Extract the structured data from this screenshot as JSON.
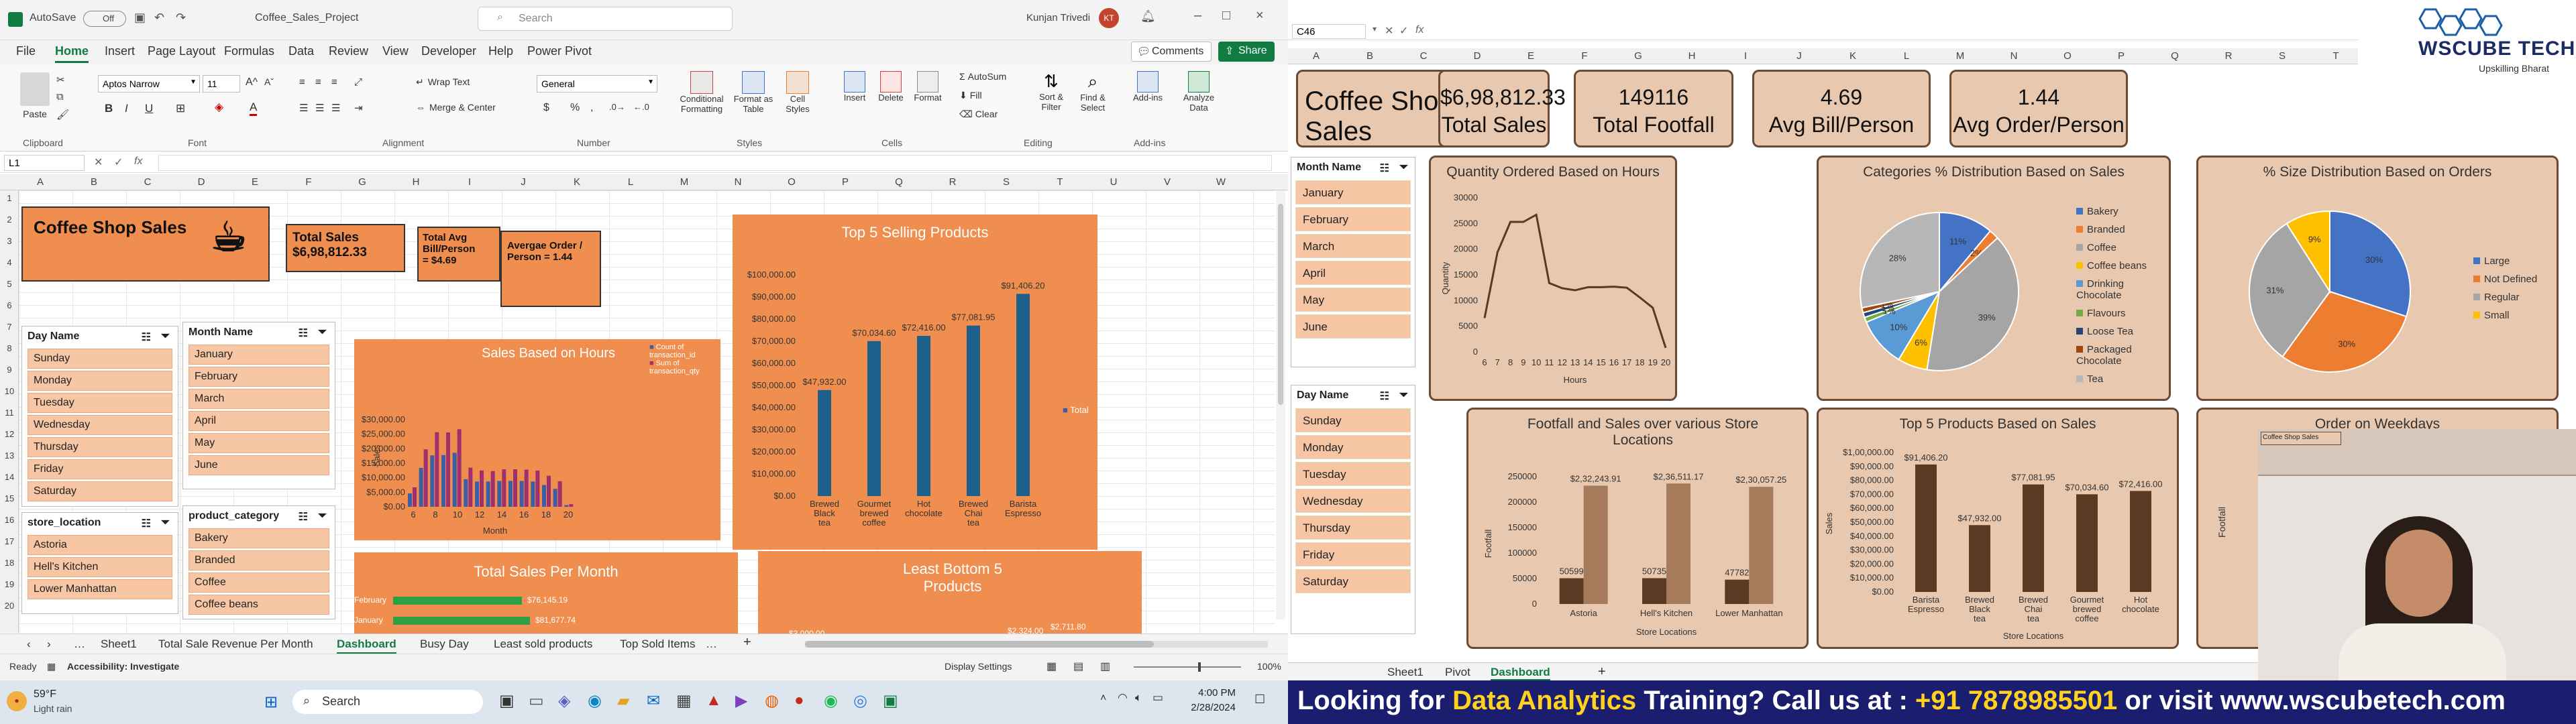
{
  "left": {
    "autosave": "AutoSave",
    "autosave_state": "Off",
    "file_name": "Coffee_Sales_Project",
    "search_placeholder": "Search",
    "user": "Kunjan Trivedi",
    "user_initials": "KT",
    "tabs": [
      "File",
      "Home",
      "Insert",
      "Page Layout",
      "Formulas",
      "Data",
      "Review",
      "View",
      "Developer",
      "Help",
      "Power Pivot"
    ],
    "comments": "Comments",
    "share": "Share",
    "ribbon": {
      "paste": "Paste",
      "clipboard": "Clipboard",
      "font_name": "Aptos Narrow",
      "font_size": "11",
      "font": "Font",
      "wrap_text": "Wrap Text",
      "merge_center": "Merge & Center",
      "alignment": "Alignment",
      "number_format": "General",
      "number": "Number",
      "conditional": "Conditional Formatting",
      "format_table": "Format as Table",
      "cell_styles": "Cell Styles",
      "styles": "Styles",
      "insert": "Insert",
      "delete": "Delete",
      "format": "Format",
      "cells": "Cells",
      "autosum": "AutoSum",
      "fill": "Fill",
      "clear": "Clear",
      "sort_filter": "Sort & Filter",
      "find_select": "Find & Select",
      "editing": "Editing",
      "addins": "Add-ins",
      "analyze": "Analyze Data"
    },
    "name_box": "L1",
    "columns": [
      "A",
      "B",
      "C",
      "D",
      "E",
      "F",
      "G",
      "H",
      "I",
      "J",
      "K",
      "L",
      "M",
      "N",
      "O",
      "P",
      "Q",
      "R",
      "S",
      "T",
      "U",
      "V",
      "W"
    ],
    "rows": [
      "1",
      "2",
      "3",
      "4",
      "5",
      "6",
      "7",
      "8",
      "9",
      "10",
      "11",
      "12",
      "13",
      "14",
      "15",
      "16",
      "17",
      "18",
      "19",
      "20"
    ],
    "title_card": "Coffee Shop Sales",
    "total_sales_label": "Total Sales",
    "total_sales_value": "$6,98,812.33",
    "avg_bill_label": "Total Avg Bill/Person",
    "avg_bill_value": "= $4.69",
    "avg_order": "Avergae Order / Person = 1.44",
    "day_slicer": {
      "title": "Day Name",
      "items": [
        "Sunday",
        "Monday",
        "Tuesday",
        "Wednesday",
        "Thursday",
        "Friday",
        "Saturday"
      ]
    },
    "month_slicer": {
      "title": "Month Name",
      "items": [
        "January",
        "February",
        "March",
        "April",
        "May",
        "June"
      ]
    },
    "store_slicer": {
      "title": "store_location",
      "items": [
        "Astoria",
        "Hell's Kitchen",
        "Lower Manhattan"
      ]
    },
    "category_slicer": {
      "title": "product_category",
      "items": [
        "Bakery",
        "Branded",
        "Coffee",
        "Coffee beans"
      ]
    },
    "sales_hours_title": "Sales Based on Hours",
    "sales_hours_legend": [
      "Count of transaction_id",
      "Sum of transaction_qty"
    ],
    "sales_hours_ylabel": "Sales",
    "sales_hours_xlabel": "Month",
    "sales_hours_yticks": [
      "$30,000.00",
      "$25,000.00",
      "$20,000.00",
      "$15,000.00",
      "$10,000.00",
      "$5,000.00",
      "$0.00"
    ],
    "sales_hours_xticks": [
      "6",
      "8",
      "10",
      "12",
      "14",
      "16",
      "18",
      "20"
    ],
    "top5_title": "Top 5 Selling Products",
    "top5_legend": "Total",
    "total_per_month_title": "Total Sales Per Month",
    "total_per_month_rows": [
      {
        "label": "February",
        "value": "$76,145.19"
      },
      {
        "label": "January",
        "value": "$81,677.74"
      }
    ],
    "least5_title": "Least Bottom 5 Products",
    "least5_values": [
      "$3,000.00",
      "$2,324.00",
      "$2,711.80"
    ],
    "sheet_tabs": [
      "Sheet1",
      "Total Sale Revenue Per Month",
      "Dashboard",
      "Busy Day",
      "Least sold products",
      "Top Sold Items"
    ],
    "active_sheet": "Dashboard",
    "status_ready": "Ready",
    "accessibility": "Accessibility: Investigate",
    "display_settings": "Display Settings",
    "zoom": "100%"
  },
  "right": {
    "name_box": "C46",
    "columns": [
      "A",
      "B",
      "C",
      "D",
      "E",
      "F",
      "G",
      "H",
      "I",
      "J",
      "K",
      "L",
      "M",
      "N",
      "O",
      "P",
      "Q",
      "R",
      "S",
      "T"
    ],
    "title": "Coffee Shop Sales",
    "kpis": [
      {
        "value": "$6,98,812.33",
        "label": "Total Sales"
      },
      {
        "value": "149116",
        "label": "Total Footfall"
      },
      {
        "value": "4.69",
        "label": "Avg Bill/Person"
      },
      {
        "value": "1.44",
        "label": "Avg Order/Person"
      }
    ],
    "month_slicer": {
      "title": "Month Name",
      "items": [
        "January",
        "February",
        "March",
        "April",
        "May",
        "June"
      ]
    },
    "day_slicer": {
      "title": "Day Name",
      "items": [
        "Sunday",
        "Monday",
        "Tuesday",
        "Wednesday",
        "Thursday",
        "Friday",
        "Saturday"
      ]
    },
    "qty_hours_title": "Quantity Ordered Based on Hours",
    "qty_hours_ylabel": "Quantity",
    "qty_hours_xlabel": "Hours",
    "categories_title": "Categories % Distribution Based on Sales",
    "categories_legend": [
      "Bakery",
      "Branded",
      "Coffee",
      "Coffee beans",
      "Drinking Chocolate",
      "Flavours",
      "Loose Tea",
      "Packaged Chocolate",
      "Tea"
    ],
    "size_title": "% Size Distribution Based on Orders",
    "size_legend": [
      "Large",
      "Not Defined",
      "Regular",
      "Small"
    ],
    "footfall_title": "Footfall and Sales over various Store Locations",
    "footfall_ylabel": "Footfall",
    "footfall_xlabel": "Store Locations",
    "top5_title": "Top 5 Products Based on Sales",
    "top5_ylabel": "Sales",
    "top5_xlabel": "Store Locations",
    "weekday_title": "Order on Weekdays",
    "weekday_ylabel": "Footfall",
    "sheet_tabs": [
      "Sheet1",
      "Pivot",
      "Dashboard"
    ],
    "active_sheet": "Dashboard"
  },
  "taskbar": {
    "weather_temp": "59°F",
    "weather_desc": "Light rain",
    "search": "Search",
    "time": "4:00 PM",
    "date": "2/28/2024"
  },
  "logo": {
    "name": "WSCUBE TECH",
    "tagline": "Upskilling Bharat"
  },
  "banner": {
    "part1": "Looking for ",
    "part2": "Data Analytics",
    "part3": " Training? Call us at : ",
    "part4": "+91 7878985501",
    "part5": " or visit www.wscubetech.com"
  },
  "colors": {
    "accent_orange": "#ef8e4e",
    "panel_bg": "#e8c9b0",
    "panel_border": "#6b4a33",
    "brown_dark": "#5a3a22",
    "brown_light": "#a67b5b",
    "excel_green": "#107c41",
    "banner_bg": "#1b1d6e",
    "banner_yellow": "#ffd21f"
  },
  "chart_data": [
    {
      "type": "bar",
      "title": "Top 5 Selling Products",
      "categories": [
        "Brewed Black tea",
        "Gourmet brewed coffee",
        "Hot chocolate",
        "Brewed Chai tea",
        "Barista Espresso"
      ],
      "values": [
        47932,
        70034.6,
        72416,
        77081.95,
        91406.2
      ],
      "labels": [
        "$47,932.00",
        "$70,034.60",
        "$72,416.00",
        "$77,081.95",
        "$91,406.20"
      ],
      "yticks": [
        "$100,000.00",
        "$90,000.00",
        "$80,000.00",
        "$70,000.00",
        "$60,000.00",
        "$50,000.00",
        "$40,000.00",
        "$30,000.00",
        "$20,000.00",
        "$10,000.00",
        "$0.00"
      ],
      "ylim": [
        0,
        100000
      ]
    },
    {
      "type": "bar",
      "title": "Sales Based on Hours",
      "x": [
        6,
        7,
        8,
        9,
        10,
        11,
        12,
        13,
        14,
        15,
        16,
        17,
        18,
        19,
        20
      ],
      "series": [
        {
          "name": "Count of transaction_id",
          "values": [
            4600,
            13400,
            17700,
            17800,
            18600,
            9500,
            8700,
            8700,
            8900,
            8900,
            8900,
            8700,
            7500,
            6200,
            600
          ]
        },
        {
          "name": "Sum of transaction_qty",
          "values": [
            6700,
            19800,
            25700,
            25600,
            26700,
            13500,
            12500,
            12300,
            12900,
            12900,
            12800,
            12500,
            10700,
            8800,
            900
          ]
        }
      ],
      "ylim": [
        0,
        30000
      ]
    },
    {
      "type": "line",
      "title": "Quantity Ordered Based on Hours",
      "xlabel": "Hours",
      "ylabel": "Quantity",
      "x": [
        6,
        7,
        8,
        9,
        10,
        11,
        12,
        13,
        14,
        15,
        16,
        17,
        18,
        19,
        20
      ],
      "values": [
        6600,
        19400,
        25300,
        25300,
        26700,
        13400,
        12400,
        12000,
        12600,
        12600,
        12700,
        12500,
        10600,
        8600,
        800
      ],
      "yticks": [
        "30000",
        "25000",
        "20000",
        "15000",
        "10000",
        "5000",
        "0"
      ],
      "ylim": [
        0,
        30000
      ]
    },
    {
      "type": "pie",
      "title": "Categories % Distribution Based on Sales",
      "labels": [
        "Bakery",
        "Branded",
        "Coffee",
        "Coffee beans",
        "Drinking Chocolate",
        "Flavours",
        "Loose Tea",
        "Packaged Chocolate",
        "Tea"
      ],
      "values": [
        11,
        2,
        39,
        6,
        10,
        1,
        1,
        1,
        28
      ],
      "colors": [
        "#4472c4",
        "#ed7d31",
        "#a5a5a5",
        "#ffc000",
        "#5b9bd5",
        "#70ad47",
        "#264478",
        "#9e480e",
        "#b7b7b7"
      ]
    },
    {
      "type": "pie",
      "title": "% Size Distribution Based on Orders",
      "labels": [
        "Large",
        "Not Defined",
        "Regular",
        "Small"
      ],
      "values": [
        30,
        30,
        31,
        9
      ],
      "label_texts": [
        "30%",
        "30%",
        "31%",
        "9%"
      ],
      "colors": [
        "#4472c4",
        "#ed7d31",
        "#a5a5a5",
        "#ffc000"
      ]
    },
    {
      "type": "bar",
      "title": "Footfall and Sales over various Store Locations",
      "xlabel": "Store Locations",
      "ylabel": "Footfall",
      "categories": [
        "Astoria",
        "Hell's Kitchen",
        "Lower Manhattan"
      ],
      "series": [
        {
          "values": [
            50599,
            50735,
            47782
          ],
          "labels": [
            "50599",
            "50735",
            "47782"
          ]
        },
        {
          "values": [
            232243.91,
            236511.17,
            230057.25
          ],
          "labels": [
            "$2,32,243.91",
            "$2,36,511.17",
            "$2,30,057.25"
          ]
        }
      ],
      "yticks": [
        "250000",
        "200000",
        "150000",
        "100000",
        "50000",
        "0"
      ],
      "ylim": [
        0,
        250000
      ]
    },
    {
      "type": "bar",
      "title": "Top 5 Products Based on Sales",
      "xlabel": "Store Locations",
      "ylabel": "Sales",
      "categories": [
        "Barista Espresso",
        "Brewed Black tea",
        "Brewed Chai tea",
        "Gourmet brewed coffee",
        "Hot chocolate"
      ],
      "values": [
        91406.2,
        47932,
        77081.95,
        70034.6,
        72416
      ],
      "labels": [
        "$91,406.20",
        "$47,932.00",
        "$77,081.95",
        "$70,034.60",
        "$72,416.00"
      ],
      "yticks": [
        "$1,00,000.00",
        "$90,000.00",
        "$80,000.00",
        "$70,000.00",
        "$60,000.00",
        "$50,000.00",
        "$40,000.00",
        "$30,000.00",
        "$20,000.00",
        "$10,000.00",
        "$0.00"
      ],
      "ylim": [
        0,
        100000
      ]
    }
  ]
}
